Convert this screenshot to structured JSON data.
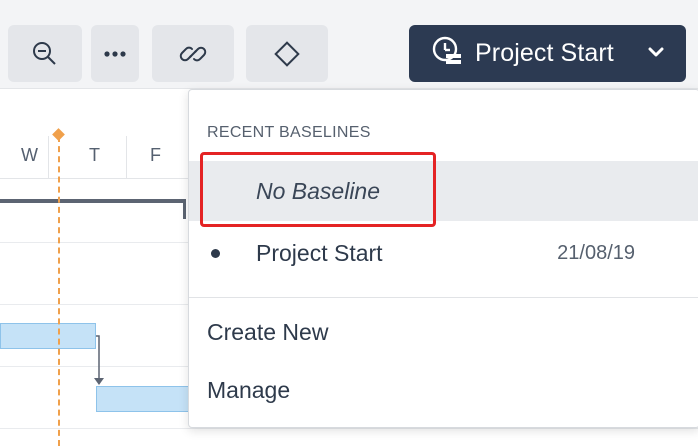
{
  "toolbar": {
    "buttons": [
      {
        "icon": "zoom-out-icon"
      },
      {
        "icon": "more-icon"
      },
      {
        "icon": "link-icon"
      },
      {
        "icon": "milestone-diamond-icon"
      }
    ],
    "baseline_button": {
      "label": "Project Start",
      "icon": "baseline-clock-icon"
    }
  },
  "gantt": {
    "days": [
      "W",
      "T",
      "F"
    ],
    "today_color": "#f0a04b"
  },
  "dropdown": {
    "heading": "RECENT BASELINES",
    "items": [
      {
        "label": "No Baseline",
        "selected": true
      },
      {
        "label": "Project Start",
        "date": "21/08/19"
      }
    ],
    "actions": [
      {
        "label": "Create New"
      },
      {
        "label": "Manage"
      }
    ]
  },
  "colors": {
    "accent": "#2c3a52",
    "highlight": "#e42324",
    "task_bar": "#c5e2f7"
  }
}
